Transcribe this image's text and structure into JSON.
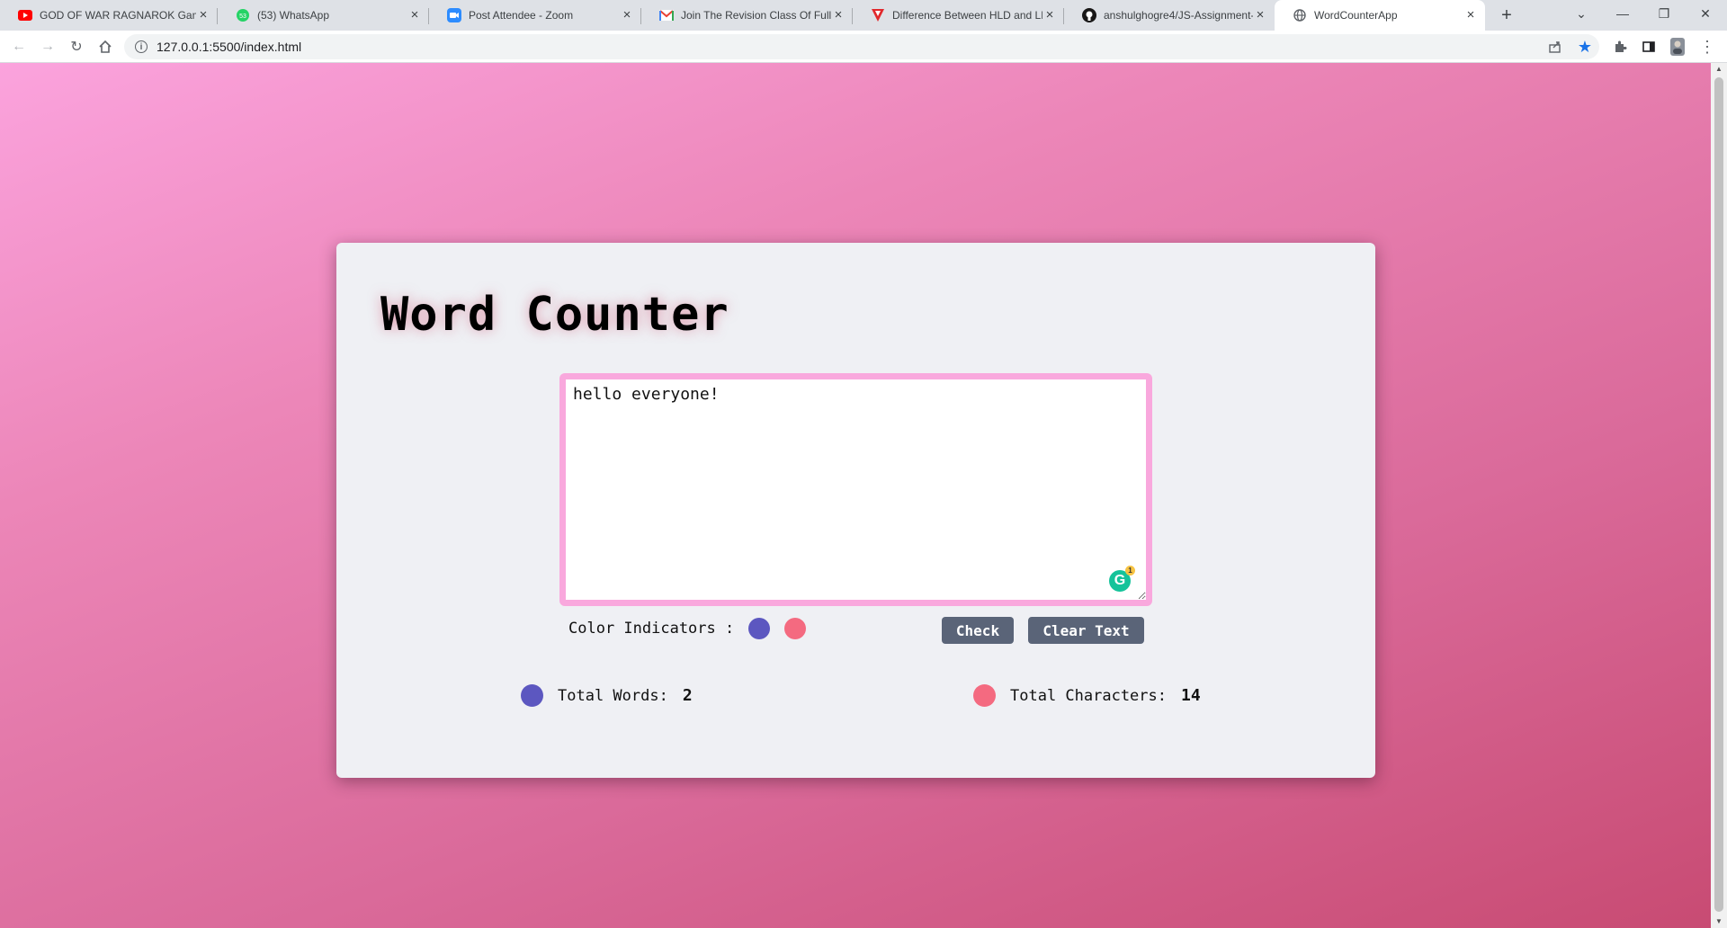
{
  "browser": {
    "tabs": [
      {
        "title": "GOD OF WAR RAGNAROK Game",
        "icon": "youtube-icon"
      },
      {
        "title": "(53) WhatsApp",
        "icon": "whatsapp-icon"
      },
      {
        "title": "Post Attendee - Zoom",
        "icon": "zoom-icon"
      },
      {
        "title": "Join The Revision Class Of Full St",
        "icon": "gmail-icon"
      },
      {
        "title": "Difference Between HLD and LLD",
        "icon": "site-icon"
      },
      {
        "title": "anshulghogre4/JS-Assignment-",
        "icon": "github-icon"
      },
      {
        "title": "WordCounterApp",
        "icon": "globe-icon",
        "active": true
      }
    ],
    "url": "127.0.0.1:5500/index.html"
  },
  "app": {
    "heading": "Word Counter",
    "textarea_value": "hello everyone!",
    "grammarly_count": "1",
    "indicators_label": "Color Indicators :",
    "check_label": "Check",
    "clear_label": "Clear Text",
    "words_label": "Total Words:",
    "words_value": "2",
    "chars_label": "Total Characters:",
    "chars_value": "14"
  },
  "colors": {
    "words_indicator": "#5c57c0",
    "chars_indicator": "#f46a80",
    "textarea_border": "#f9a8dd",
    "button_bg": "#5a6478"
  }
}
